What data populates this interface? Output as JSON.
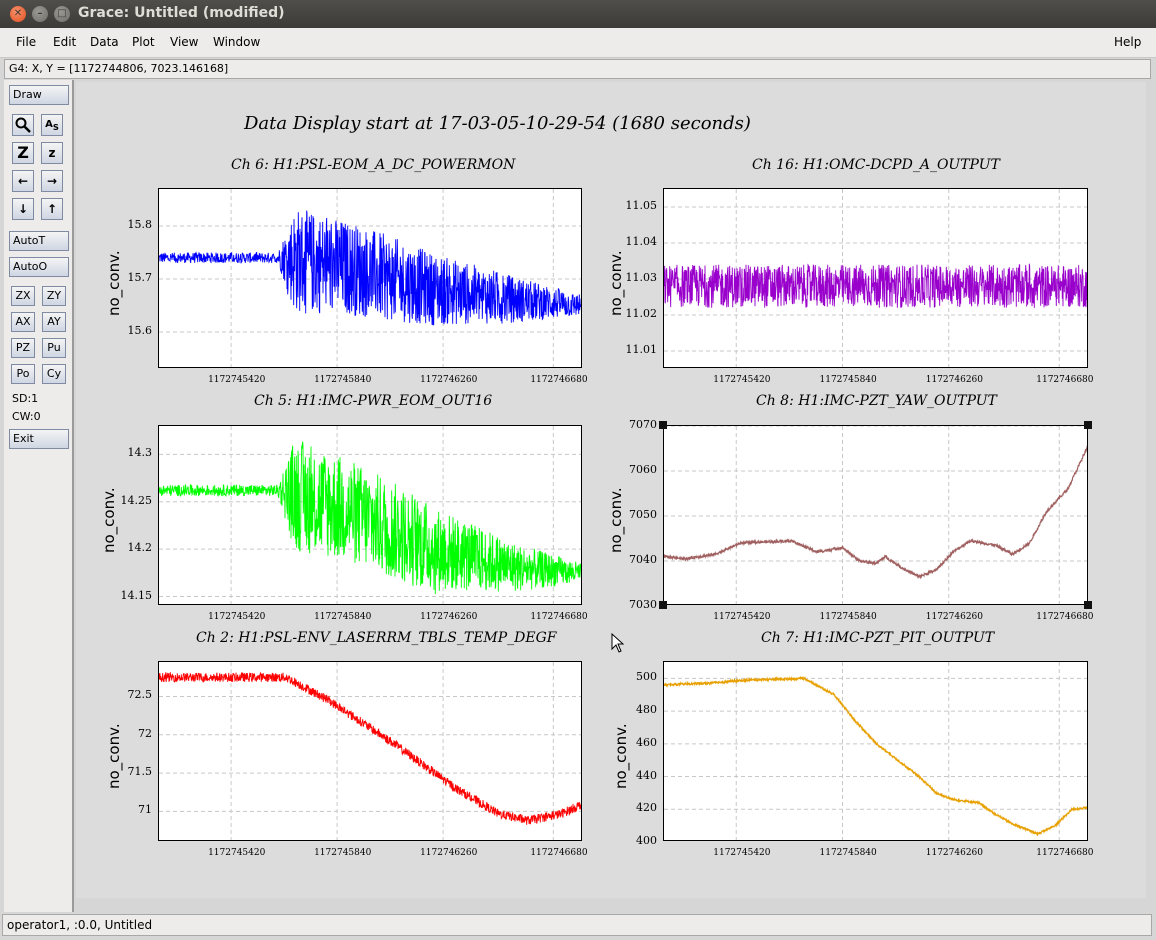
{
  "window": {
    "title": "Grace: Untitled (modified)"
  },
  "menu": {
    "file": "File",
    "edit": "Edit",
    "data": "Data",
    "plot": "Plot",
    "view": "View",
    "window": "Window",
    "help": "Help"
  },
  "locator": "G4: X, Y = [1172744806, 7023.146168]",
  "tools": {
    "draw": "Draw",
    "autot": "AutoT",
    "autoo": "AutoO",
    "zx": "ZX",
    "zy": "ZY",
    "ax": "AX",
    "ay": "AY",
    "pz": "PZ",
    "pu": "Pu",
    "po": "Po",
    "cy": "Cy",
    "sd": "SD:1",
    "cw": "CW:0",
    "exit": "Exit",
    "icons": [
      "zoom-icon",
      "text-icon",
      "autoscale-icon",
      "zoom-icon",
      "left-arrow-icon",
      "right-arrow-icon",
      "down-arrow-icon",
      "up-arrow-icon"
    ]
  },
  "main_title": "Data Display start at 17-03-05-10-29-54 (1680 seconds)",
  "status": "operator1, :0.0, Untitled",
  "chart_data": [
    {
      "type": "line",
      "title": "Ch 6: H1:PSL-EOM_A_DC_POWERMON",
      "ylabel": "no_conv.",
      "color": "#0000ff",
      "xticks": [
        "1172745420",
        "1172745840",
        "1172746260",
        "1172746680"
      ],
      "yticks": [
        "15.8",
        "15.7",
        "15.6"
      ],
      "ylim": [
        15.53,
        15.87
      ],
      "xlim": [
        1172745000,
        1172746680
      ],
      "trend": [
        [
          0,
          15.74
        ],
        [
          0.29,
          15.74
        ],
        [
          0.45,
          15.72
        ],
        [
          0.65,
          15.68
        ],
        [
          0.85,
          15.66
        ],
        [
          1.0,
          15.65
        ]
      ],
      "noise": [
        [
          0,
          0.01
        ],
        [
          0.28,
          0.01
        ],
        [
          0.32,
          0.1
        ],
        [
          0.55,
          0.08
        ],
        [
          0.8,
          0.05
        ],
        [
          1.0,
          0.02
        ]
      ]
    },
    {
      "type": "line",
      "title": "Ch 16: H1:OMC-DCPD_A_OUTPUT",
      "ylabel": "no_conv.",
      "color": "#9900cc",
      "xticks": [
        "1172745420",
        "1172745840",
        "1172746260",
        "1172746680"
      ],
      "yticks": [
        "11.05",
        "11.04",
        "11.03",
        "11.02",
        "11.01"
      ],
      "ylim": [
        11.005,
        11.055
      ],
      "xlim": [
        1172745000,
        1172746680
      ],
      "trend": [
        [
          0,
          11.028
        ],
        [
          1.0,
          11.028
        ]
      ],
      "noise": [
        [
          0,
          0.006
        ],
        [
          1.0,
          0.006
        ]
      ]
    },
    {
      "type": "line",
      "title": "Ch 5: H1:IMC-PWR_EOM_OUT16",
      "ylabel": "no_conv.",
      "color": "#00ff00",
      "xticks": [
        "1172745420",
        "1172745840",
        "1172746260",
        "1172746680"
      ],
      "yticks": [
        "14.3",
        "14.25",
        "14.2",
        "14.15"
      ],
      "ylim": [
        14.14,
        14.33
      ],
      "xlim": [
        1172745000,
        1172746680
      ],
      "trend": [
        [
          0,
          14.262
        ],
        [
          0.29,
          14.262
        ],
        [
          0.45,
          14.24
        ],
        [
          0.65,
          14.2
        ],
        [
          0.85,
          14.18
        ],
        [
          1.0,
          14.175
        ]
      ],
      "noise": [
        [
          0,
          0.006
        ],
        [
          0.28,
          0.006
        ],
        [
          0.32,
          0.06
        ],
        [
          0.6,
          0.05
        ],
        [
          0.8,
          0.03
        ],
        [
          1.0,
          0.01
        ]
      ]
    },
    {
      "type": "line",
      "title": "Ch 8: H1:IMC-PZT_YAW_OUTPUT",
      "ylabel": "no_conv.",
      "color": "#a06060",
      "xticks": [
        "1172745420",
        "1172745840",
        "1172746260",
        "1172746680"
      ],
      "yticks": [
        "7070",
        "7060",
        "7050",
        "7040",
        "7030"
      ],
      "ylim": [
        7030,
        7070
      ],
      "xlim": [
        1172745000,
        1172746680
      ],
      "trend": [
        [
          0,
          7041
        ],
        [
          0.05,
          7040.5
        ],
        [
          0.12,
          7041.5
        ],
        [
          0.18,
          7044
        ],
        [
          0.3,
          7044.5
        ],
        [
          0.36,
          7042
        ],
        [
          0.42,
          7043
        ],
        [
          0.46,
          7040
        ],
        [
          0.5,
          7039.5
        ],
        [
          0.52,
          7041
        ],
        [
          0.56,
          7038.5
        ],
        [
          0.6,
          7036.5
        ],
        [
          0.64,
          7038
        ],
        [
          0.68,
          7042
        ],
        [
          0.72,
          7044.5
        ],
        [
          0.78,
          7043.5
        ],
        [
          0.82,
          7041.5
        ],
        [
          0.86,
          7044
        ],
        [
          0.9,
          7051
        ],
        [
          0.95,
          7056
        ],
        [
          1.0,
          7066
        ]
      ],
      "noise": [
        [
          0,
          0.3
        ],
        [
          1.0,
          0.3
        ]
      ]
    },
    {
      "type": "line",
      "title": "Ch 2: H1:PSL-ENV_LASERRM_TBLS_TEMP_DEGF",
      "ylabel": "no_conv.",
      "color": "#ff0000",
      "xticks": [
        "1172745420",
        "1172745840",
        "1172746260",
        "1172746680"
      ],
      "yticks": [
        "72.5",
        "72",
        "71.5",
        "71"
      ],
      "ylim": [
        70.6,
        72.95
      ],
      "xlim": [
        1172745000,
        1172746680
      ],
      "trend": [
        [
          0,
          72.75
        ],
        [
          0.3,
          72.75
        ],
        [
          0.4,
          72.45
        ],
        [
          0.55,
          71.9
        ],
        [
          0.7,
          71.3
        ],
        [
          0.8,
          70.97
        ],
        [
          0.87,
          70.88
        ],
        [
          0.95,
          70.97
        ],
        [
          1.0,
          71.1
        ]
      ],
      "noise": [
        [
          0,
          0.06
        ],
        [
          1.0,
          0.06
        ]
      ]
    },
    {
      "type": "line",
      "title": "Ch 7: H1:IMC-PZT_PIT_OUTPUT",
      "ylabel": "no_conv.",
      "color": "#e8a000",
      "xticks": [
        "1172745420",
        "1172745840",
        "1172746260",
        "1172746680"
      ],
      "yticks": [
        "500",
        "480",
        "460",
        "440",
        "420",
        "400"
      ],
      "ylim": [
        400,
        510
      ],
      "xlim": [
        1172745000,
        1172746680
      ],
      "trend": [
        [
          0,
          496
        ],
        [
          0.1,
          497
        ],
        [
          0.2,
          499
        ],
        [
          0.33,
          500
        ],
        [
          0.4,
          490
        ],
        [
          0.45,
          474
        ],
        [
          0.5,
          460
        ],
        [
          0.55,
          450
        ],
        [
          0.6,
          440
        ],
        [
          0.64,
          430
        ],
        [
          0.68,
          426
        ],
        [
          0.74,
          424
        ],
        [
          0.78,
          417
        ],
        [
          0.82,
          411
        ],
        [
          0.88,
          405
        ],
        [
          0.92,
          410
        ],
        [
          0.96,
          420
        ],
        [
          1.0,
          421
        ]
      ],
      "noise": [
        [
          0,
          0.6
        ],
        [
          1.0,
          0.6
        ]
      ]
    }
  ]
}
